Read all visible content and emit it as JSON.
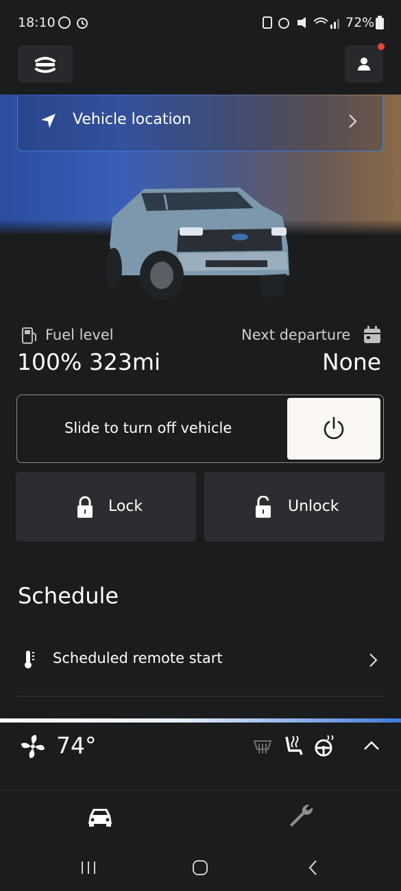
{
  "status_bar": {
    "time": "18:10",
    "battery": "72%"
  },
  "location": {
    "label": "Vehicle location"
  },
  "fuel": {
    "label": "Fuel level",
    "value": "100% 323mi"
  },
  "departure": {
    "label": "Next departure",
    "value": "None"
  },
  "remote": {
    "slider_label": "Slide to turn off vehicle"
  },
  "lock": {
    "lock_label": "Lock",
    "unlock_label": "Unlock"
  },
  "schedule": {
    "title": "Schedule",
    "item": "Scheduled remote start"
  },
  "climate": {
    "temperature": "74°"
  },
  "colors": {
    "accent": "#3f7ad8",
    "notification_dot": "#e5463a",
    "background": "#1b1c1e",
    "card": "#2c2d30"
  },
  "icons": [
    "navigation-arrow-icon",
    "chevron-right-icon",
    "fuel-pump-icon",
    "calendar-icon",
    "power-icon",
    "lock-icon",
    "unlock-icon",
    "thermometer-icon",
    "fan-icon",
    "rear-defrost-icon",
    "heated-seat-icon",
    "heated-steering-wheel-icon",
    "chevron-up-icon",
    "car-icon",
    "wrench-icon",
    "profile-icon",
    "menu-vehicle-icon"
  ]
}
